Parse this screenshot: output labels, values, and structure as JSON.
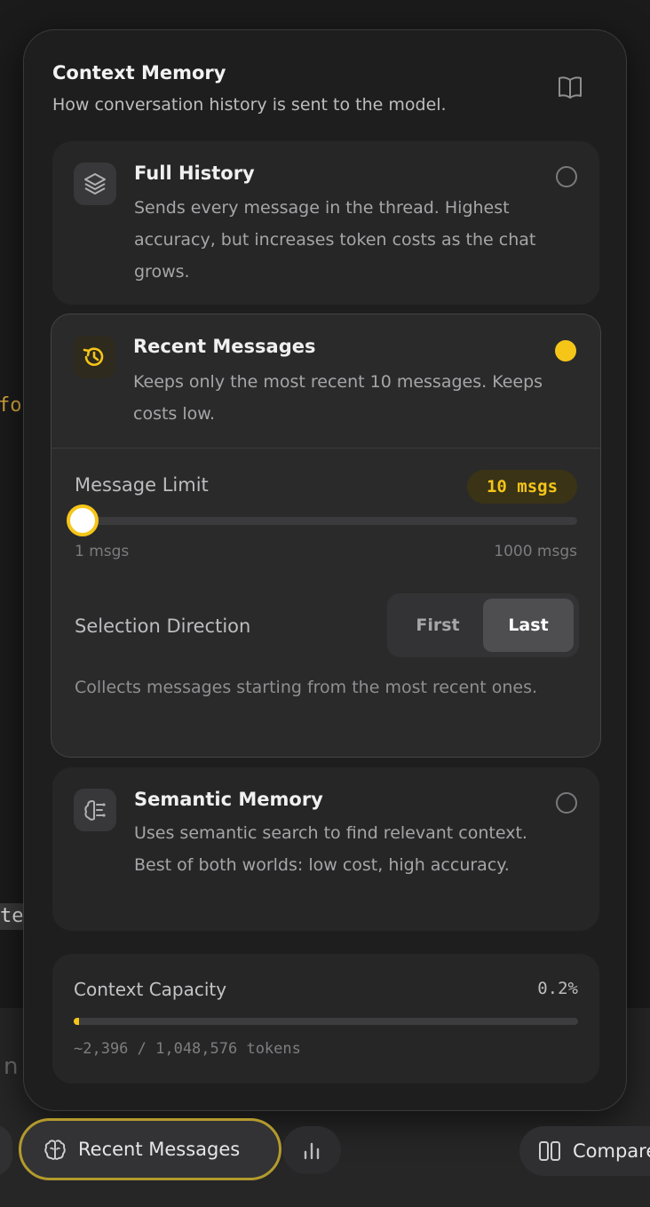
{
  "background": {
    "fragment_fo": "fo",
    "fragment_te": "te",
    "fragment_n": "n"
  },
  "panel": {
    "title": "Context Memory",
    "subtitle": "How conversation history is sent to the model.",
    "header_icon": "book-open-icon"
  },
  "options": [
    {
      "title": "Full History",
      "description": "Sends every message in the thread. Highest accuracy, but increases token costs as the chat grows.",
      "icon": "layers-icon",
      "selected": false
    },
    {
      "title": "Recent Messages",
      "description": "Keeps only the most recent 10 messages. Keeps costs low.",
      "icon": "history-icon",
      "selected": true
    },
    {
      "title": "Semantic Memory",
      "description": "Uses semantic search to find relevant context. Best of both worlds: low cost, high accuracy.",
      "icon": "brain-icon",
      "selected": false
    }
  ],
  "recent_settings": {
    "limit_label": "Message Limit",
    "limit_badge": "10 msgs",
    "limit_value": 10,
    "limit_min_label": "1 msgs",
    "limit_max_label": "1000 msgs",
    "limit_min": 1,
    "limit_max": 1000,
    "direction_label": "Selection Direction",
    "direction_options": [
      "First",
      "Last"
    ],
    "direction_selected": "Last",
    "direction_description": "Collects messages starting from the most recent ones."
  },
  "capacity": {
    "label": "Context Capacity",
    "percent_label": "0.2%",
    "percent": 0.2,
    "tokens_label": "~2,396 / 1,048,576 tokens"
  },
  "bottom_bar": {
    "memory_button_label": "Recent Messages",
    "memory_button_icon": "brain-icon",
    "chart_button_icon": "bar-chart-icon",
    "compare_button_label": "Compare",
    "compare_button_icon": "columns-icon"
  },
  "colors": {
    "accent": "#f5c518",
    "panel": "#1e1e1f",
    "card": "#262627"
  }
}
